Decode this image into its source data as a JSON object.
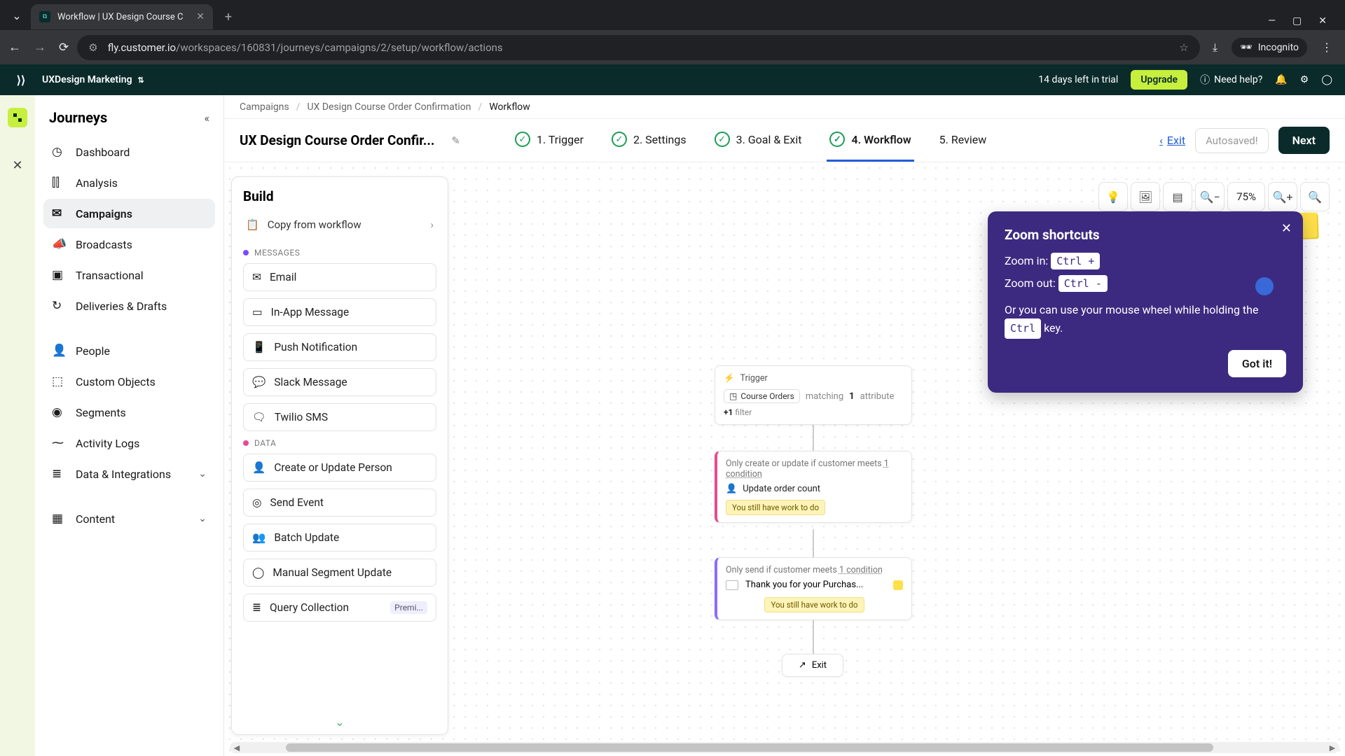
{
  "browser": {
    "tab_title": "Workflow | UX Design Course C",
    "url_host": "fly.customer.io",
    "url_path": "/workspaces/160831/journeys/campaigns/2/setup/workflow/actions",
    "incognito": "Incognito"
  },
  "topnav": {
    "workspace": "UXDesign Marketing",
    "trial": "14 days left in trial",
    "upgrade": "Upgrade",
    "need_help": "Need help?"
  },
  "sidebar": {
    "title": "Journeys",
    "items": [
      {
        "label": "Dashboard"
      },
      {
        "label": "Analysis"
      },
      {
        "label": "Campaigns",
        "active": true
      },
      {
        "label": "Broadcasts"
      },
      {
        "label": "Transactional"
      },
      {
        "label": "Deliveries & Drafts"
      }
    ],
    "items2": [
      {
        "label": "People"
      },
      {
        "label": "Custom Objects"
      },
      {
        "label": "Segments"
      },
      {
        "label": "Activity Logs"
      },
      {
        "label": "Data & Integrations",
        "chev": true
      },
      {
        "label": "Content",
        "chev": true
      }
    ]
  },
  "breadcrumb": {
    "a": "Campaigns",
    "b": "UX Design Course Order Confirmation",
    "c": "Workflow"
  },
  "header": {
    "title": "UX Design Course Order Confir...",
    "steps": [
      {
        "label": "1. Trigger",
        "done": true
      },
      {
        "label": "2. Settings",
        "done": true
      },
      {
        "label": "3. Goal & Exit",
        "done": true
      },
      {
        "label": "4. Workflow",
        "done": true,
        "active": true
      },
      {
        "label": "5. Review"
      }
    ],
    "exit": "Exit",
    "autosaved": "Autosaved!",
    "next": "Next"
  },
  "build": {
    "title": "Build",
    "copy": "Copy from workflow",
    "groups": {
      "messages": "MESSAGES",
      "data": "DATA"
    },
    "messages": [
      "Email",
      "In-App Message",
      "Push Notification",
      "Slack Message",
      "Twilio SMS"
    ],
    "data": [
      "Create or Update Person",
      "Send Event",
      "Batch Update",
      "Manual Segment Update"
    ],
    "query": {
      "label": "Query Collection",
      "badge": "Premi..."
    }
  },
  "toolbar": {
    "zoom": "75%"
  },
  "popover": {
    "title": "Zoom shortcuts",
    "zoom_in_label": "Zoom in:",
    "zoom_in_key": "Ctrl +",
    "zoom_out_label": "Zoom out:",
    "zoom_out_key": "Ctrl -",
    "hint_pre": "Or you can use your mouse wheel while holding the",
    "hint_key": "Ctrl",
    "hint_post": "key.",
    "got_it": "Got it!"
  },
  "workflow": {
    "trigger": {
      "head": "Trigger",
      "chip": "Course Orders",
      "matching": "matching",
      "count": "1",
      "attr": "attribute",
      "filter_plus": "+1",
      "filter_word": "filter"
    },
    "update": {
      "cond_pre": "Only create or update if customer meets",
      "cond_link": "1 condition",
      "action": "Update order count",
      "warn": "You still have work to do"
    },
    "email": {
      "cond_pre": "Only send if customer meets",
      "cond_link": "1 condition",
      "subject": "Thank you for your Purchas...",
      "warn": "You still have work to do"
    },
    "exit": "Exit"
  }
}
